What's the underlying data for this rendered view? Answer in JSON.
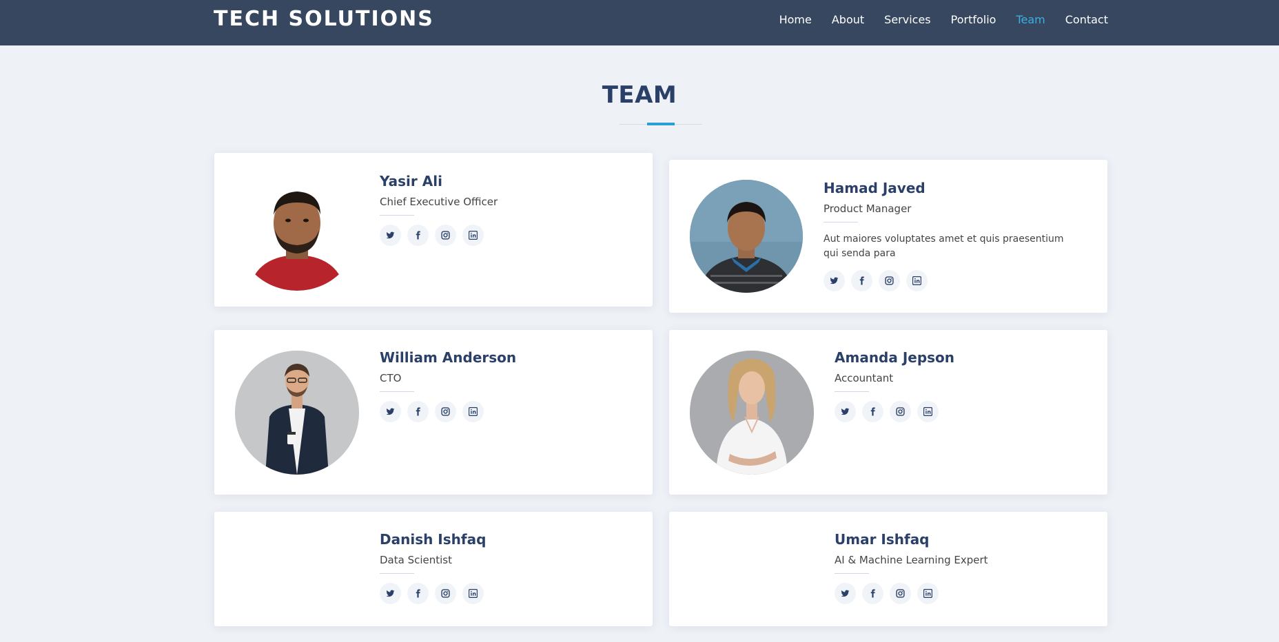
{
  "header": {
    "logo": "TECH SOLUTIONS",
    "nav": [
      "Home",
      "About",
      "Services",
      "Portfolio",
      "Team",
      "Contact"
    ],
    "active_nav": "Team",
    "bg_color": "#37475f",
    "accent_color": "#3ab0e2"
  },
  "section": {
    "title": "TEAM"
  },
  "members": [
    {
      "name": "Yasir Ali",
      "role": "Chief Executive Officer",
      "description": ""
    },
    {
      "name": "Hamad Javed",
      "role": "Product Manager",
      "description": "Aut maiores voluptates amet et quis praesentium qui senda para"
    },
    {
      "name": "William Anderson",
      "role": "CTO",
      "description": ""
    },
    {
      "name": "Amanda Jepson",
      "role": "Accountant",
      "description": ""
    },
    {
      "name": "Danish Ishfaq",
      "role": "Data Scientist",
      "description": ""
    },
    {
      "name": "Umar Ishfaq",
      "role": "AI & Machine Learning Expert",
      "description": ""
    }
  ],
  "social_icons": [
    "twitter-icon",
    "facebook-icon",
    "instagram-icon",
    "linkedin-icon"
  ]
}
